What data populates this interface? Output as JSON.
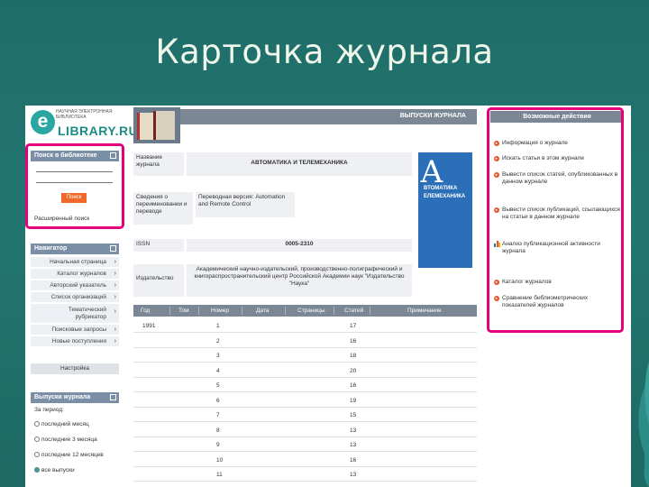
{
  "slide": {
    "title": "Карточка журнала"
  },
  "logo": {
    "letter": "e",
    "subtitle": "НАУЧНАЯ ЭЛЕКТРОННАЯ БИБЛИОТЕКА",
    "name": "LIBRARY.RU"
  },
  "search": {
    "header": "Поиск в библиотеке",
    "button": "Поиск",
    "advanced": "Расширенный поиск"
  },
  "navigation": {
    "header": "Навигатор",
    "items": [
      "Начальная страница",
      "Каталог журналов",
      "Авторский указатель",
      "Список организаций",
      "Тематический рубрикатор",
      "Поисковые запросы",
      "Новые поступления"
    ],
    "button": "Настройка"
  },
  "issues": {
    "header": "Выпуски журнала",
    "period_label": "За период:",
    "options": [
      "последний месяц",
      "последние 3 месяца",
      "последние 12 месяцев",
      "все выпуски"
    ],
    "selected_index": 3
  },
  "journal": {
    "banner": "ВЫПУСКИ ЖУРНАЛА",
    "fields": [
      {
        "label": "Название журнала",
        "value": "АВТОМАТИКА И ТЕЛЕМЕХАНИКА"
      },
      {
        "label": "Сведения о переименовании и переводе",
        "value": "Переводная версия: Automation and Remote Control"
      },
      {
        "label": "ISSN",
        "value": "0005-2310"
      },
      {
        "label": "Издательство",
        "value": "Академический научно-издательский, производственно-полиграфический и книгораспространительский центр Российской Академии наук \"Издательство \"Наука\""
      }
    ],
    "cover_title": "ВТОМАТИКА ЕЛЕМЕХАНИКА",
    "cover_letter": "А"
  },
  "table": {
    "headers": [
      "Год",
      "Том",
      "Номер",
      "Дата",
      "Страницы",
      "Статей",
      "Примечание"
    ],
    "rows": [
      {
        "year": "1991",
        "number": "1",
        "articles": "17"
      },
      {
        "year": "",
        "number": "2",
        "articles": "16"
      },
      {
        "year": "",
        "number": "3",
        "articles": "18"
      },
      {
        "year": "",
        "number": "4",
        "articles": "20"
      },
      {
        "year": "",
        "number": "5",
        "articles": "16"
      },
      {
        "year": "",
        "number": "6",
        "articles": "19"
      },
      {
        "year": "",
        "number": "7",
        "articles": "15"
      },
      {
        "year": "",
        "number": "8",
        "articles": "13"
      },
      {
        "year": "",
        "number": "9",
        "articles": "13"
      },
      {
        "year": "",
        "number": "10",
        "articles": "16"
      },
      {
        "year": "",
        "number": "11",
        "articles": "13"
      }
    ]
  },
  "actions": {
    "header": "Возможные действия",
    "items": [
      {
        "icon": "bullet",
        "label": "Информация о журнале"
      },
      {
        "icon": "bullet",
        "label": "Искать статьи в этом журнале"
      },
      {
        "icon": "bullet",
        "label": "Вывести список статей, опубликованных в данном журнале"
      },
      {
        "icon": "bullet",
        "label": "Вывести список публикаций, ссылающихся на статьи в данном журнале"
      },
      {
        "icon": "bar-chart",
        "label": "Анализ публикационной активности журнала"
      },
      {
        "icon": "bullet",
        "label": "Каталог журналов"
      },
      {
        "icon": "bullet",
        "label": "Сравнение библиометрических показателей журналов"
      }
    ]
  },
  "colors": {
    "background": "#1f6d6a",
    "highlight": "#e4007c",
    "header_gray": "#7b8794",
    "accent_orange": "#ef6a2a",
    "logo_teal": "#2aa7a2",
    "cover_blue": "#2a6fb8"
  }
}
